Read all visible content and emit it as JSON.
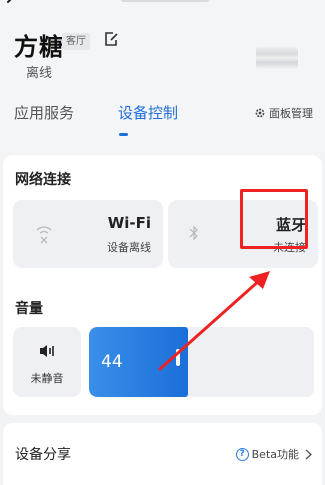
{
  "header": {
    "device_name": "方糖",
    "room_badge": "客厅",
    "status": "离线"
  },
  "tabs": [
    {
      "label": "应用服务",
      "active": false
    },
    {
      "label": "设备控制",
      "active": true
    }
  ],
  "panel_management": {
    "label": "面板管理",
    "icon": "gear-icon"
  },
  "network": {
    "title": "网络连接",
    "wifi": {
      "name": "Wi-Fi",
      "status": "设备离线",
      "icon": "wifi-off-icon"
    },
    "bluetooth": {
      "name": "蓝牙",
      "status": "未连接",
      "icon": "bluetooth-icon"
    }
  },
  "volume": {
    "title": "音量",
    "mute_label": "未静音",
    "level": 44,
    "max": 100
  },
  "share": {
    "label": "设备分享",
    "beta_label": "Beta功能"
  },
  "colors": {
    "accent": "#1e6fd9",
    "highlight": "#ee2222"
  }
}
